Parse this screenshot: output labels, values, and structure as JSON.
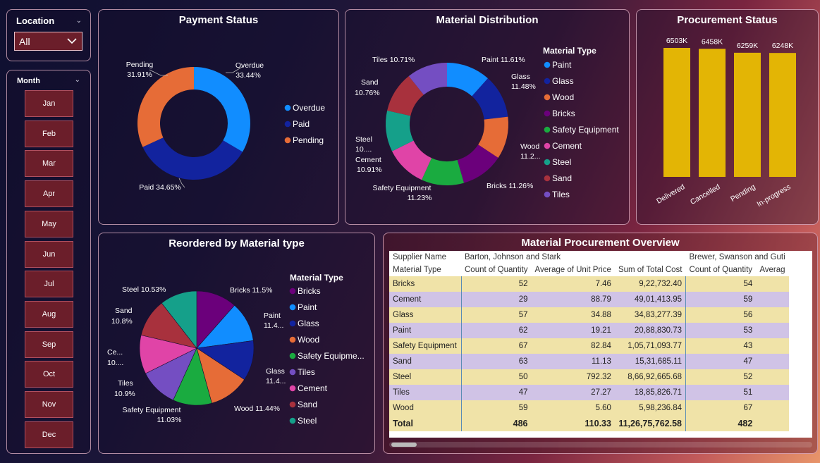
{
  "location": {
    "title": "Location",
    "selected": "All"
  },
  "month": {
    "title": "Month",
    "items": [
      "Jan",
      "Feb",
      "Mar",
      "Apr",
      "May",
      "Jun",
      "Jul",
      "Aug",
      "Sep",
      "Oct",
      "Nov",
      "Dec"
    ]
  },
  "colors": {
    "overdue": "#118dff",
    "paid": "#12239e",
    "pending": "#e66c37",
    "paint": "#118dff",
    "glass": "#12239e",
    "wood": "#e66c37",
    "bricks": "#6b007b",
    "safety": "#1aab40",
    "cement": "#e044a7",
    "steel": "#15a08a",
    "sand": "#a8313d",
    "tiles": "#744ec2",
    "bar": "#e3b505"
  },
  "payment_status": {
    "title": "Payment Status",
    "legend": [
      "Overdue",
      "Paid",
      "Pending"
    ],
    "labels": {
      "overdue_name": "Overdue",
      "overdue_pct": "33.44%",
      "paid": "Paid 34.65%",
      "pending_name": "Pending",
      "pending_pct": "31.91%"
    }
  },
  "material_distribution": {
    "title": "Material Distribution",
    "legend_title": "Material Type",
    "legend": [
      "Paint",
      "Glass",
      "Wood",
      "Bricks",
      "Safety Equipment",
      "Cement",
      "Steel",
      "Sand",
      "Tiles"
    ],
    "labels": {
      "paint": "Paint 11.61%",
      "glass_name": "Glass",
      "glass_pct": "11.48%",
      "wood_name": "Wood",
      "wood_pct": "11.2...",
      "bricks": "Bricks 11.26%",
      "safety_name": "Safety Equipment",
      "safety_pct": "11.23%",
      "cement_name": "Cement",
      "cement_pct": "10.91%",
      "steel_name": "Steel",
      "steel_pct": "10....",
      "sand_name": "Sand",
      "sand_pct": "10.76%",
      "tiles": "Tiles 10.71%"
    }
  },
  "procurement_status": {
    "title": "Procurement Status",
    "bar_labels": [
      "6503K",
      "6458K",
      "6259K",
      "6248K"
    ],
    "categories": [
      "Delivered",
      "Cancelled",
      "Pending",
      "In-progress"
    ]
  },
  "reordered": {
    "title": "Reordered by Material type",
    "legend_title": "Material Type",
    "legend": [
      "Bricks",
      "Paint",
      "Glass",
      "Wood",
      "Safety Equipme...",
      "Tiles",
      "Cement",
      "Sand",
      "Steel"
    ],
    "labels": {
      "bricks": "Bricks 11.5%",
      "paint_name": "Paint",
      "paint_pct": "11.4...",
      "glass_name": "Glass",
      "glass_pct": "11.4...",
      "wood": "Wood 11.44%",
      "safety_name": "Safety Equipment",
      "safety_pct": "11.03%",
      "tiles_name": "Tiles",
      "tiles_pct": "10.9%",
      "cement_name": "Ce...",
      "cement_pct": "10....",
      "sand_name": "Sand",
      "sand_pct": "10.8%",
      "steel": "Steel 10.53%"
    }
  },
  "table": {
    "title": "Material Procurement Overview",
    "row1_label": "Supplier Name",
    "supplier1": "Barton, Johnson and Stark",
    "supplier2": "Brewer, Swanson and Guti",
    "row2_label": "Material Type",
    "col_headers": [
      "Count of Quantity",
      "Average of Unit Price",
      "Sum of Total Cost",
      "Count of Quantity",
      "Averag"
    ],
    "rows": [
      {
        "name": "Bricks",
        "count": "52",
        "avg": "7.46",
        "sum": "9,22,732.40",
        "count2": "54"
      },
      {
        "name": "Cement",
        "count": "29",
        "avg": "88.79",
        "sum": "49,01,413.95",
        "count2": "59"
      },
      {
        "name": "Glass",
        "count": "57",
        "avg": "34.88",
        "sum": "34,83,277.39",
        "count2": "56"
      },
      {
        "name": "Paint",
        "count": "62",
        "avg": "19.21",
        "sum": "20,88,830.73",
        "count2": "53"
      },
      {
        "name": "Safety Equipment",
        "count": "67",
        "avg": "82.84",
        "sum": "1,05,71,093.77",
        "count2": "43"
      },
      {
        "name": "Sand",
        "count": "63",
        "avg": "11.13",
        "sum": "15,31,685.11",
        "count2": "47"
      },
      {
        "name": "Steel",
        "count": "50",
        "avg": "792.32",
        "sum": "8,66,92,665.68",
        "count2": "52"
      },
      {
        "name": "Tiles",
        "count": "47",
        "avg": "27.27",
        "sum": "18,85,826.71",
        "count2": "51"
      },
      {
        "name": "Wood",
        "count": "59",
        "avg": "5.60",
        "sum": "5,98,236.84",
        "count2": "67"
      }
    ],
    "total": {
      "name": "Total",
      "count": "486",
      "avg": "110.33",
      "sum": "11,26,75,762.58",
      "count2": "482"
    }
  },
  "chart_data": [
    {
      "type": "pie",
      "title": "Payment Status",
      "donut": true,
      "categories": [
        "Overdue",
        "Paid",
        "Pending"
      ],
      "values": [
        33.44,
        34.65,
        31.91
      ],
      "legend": "right"
    },
    {
      "type": "pie",
      "title": "Material Distribution",
      "donut": true,
      "categories": [
        "Paint",
        "Glass",
        "Wood",
        "Bricks",
        "Safety Equipment",
        "Cement",
        "Steel",
        "Sand",
        "Tiles"
      ],
      "values": [
        11.61,
        11.48,
        11.2,
        11.26,
        11.23,
        10.91,
        10.84,
        10.76,
        10.71
      ],
      "legend": "right"
    },
    {
      "type": "bar",
      "title": "Procurement Status",
      "categories": [
        "Delivered",
        "Cancelled",
        "Pending",
        "In-progress"
      ],
      "values": [
        6503,
        6458,
        6259,
        6248
      ],
      "data_labels": [
        "6503K",
        "6458K",
        "6259K",
        "6248K"
      ],
      "ylim": [
        0,
        6503
      ]
    },
    {
      "type": "pie",
      "title": "Reordered by Material type",
      "donut": false,
      "categories": [
        "Bricks",
        "Paint",
        "Glass",
        "Wood",
        "Safety Equipment",
        "Tiles",
        "Cement",
        "Sand",
        "Steel"
      ],
      "values": [
        11.5,
        11.4,
        11.4,
        11.44,
        11.03,
        10.9,
        11.0,
        10.8,
        10.53
      ],
      "legend": "right"
    }
  ]
}
